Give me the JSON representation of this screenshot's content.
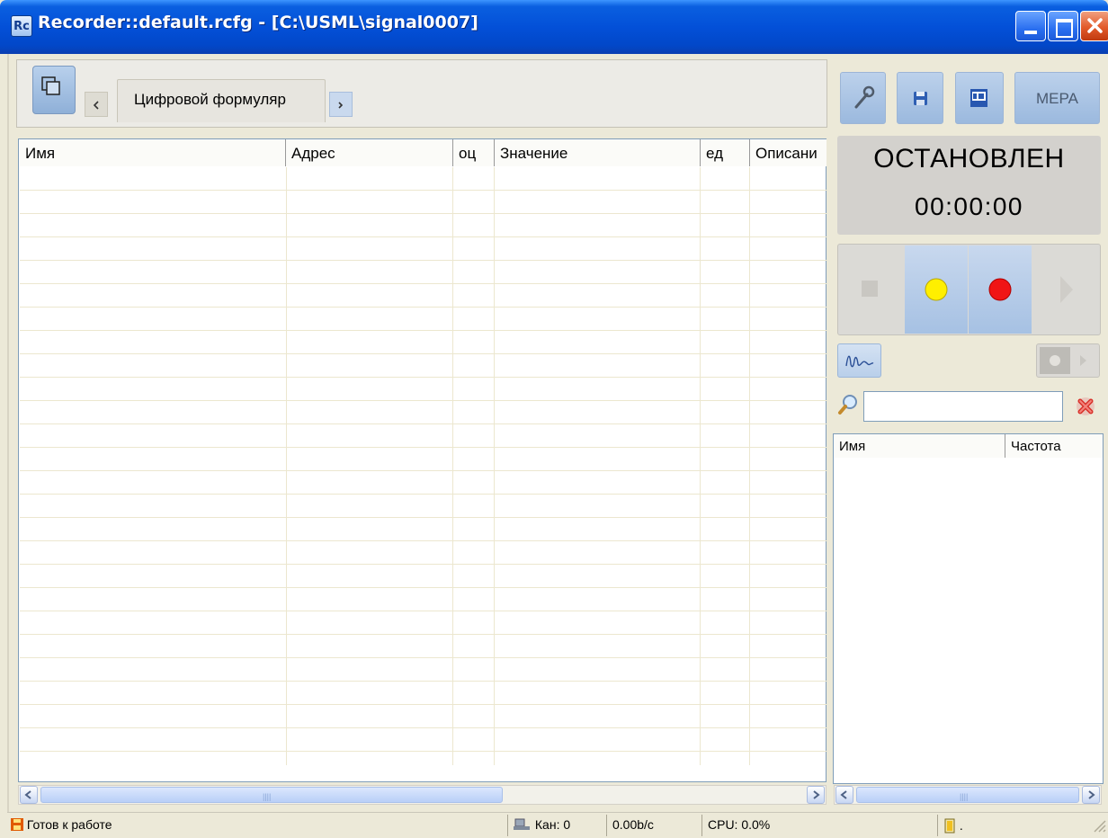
{
  "window": {
    "title": "Recorder::default.rcfg - [C:\\USML\\signal0007]",
    "icon": "Rc"
  },
  "tabs": {
    "active_label": "Цифровой формуляр"
  },
  "grid": {
    "columns": [
      "Имя",
      "Адрес",
      "оц",
      "Значение",
      "ед",
      "Описани"
    ],
    "rows": []
  },
  "toolbar": {
    "mera_label": "МЕРА",
    "icons": [
      "settings-wrench-icon",
      "save-icon",
      "doc-icon"
    ]
  },
  "recorder": {
    "status": "ОСТАНОВЛЕН",
    "timer": "00:00:00",
    "colors": {
      "pause": "#ffef00",
      "record": "#f01515"
    }
  },
  "search": {
    "value": "",
    "placeholder": ""
  },
  "channels": {
    "columns": [
      "Имя",
      "Частота"
    ],
    "rows": []
  },
  "statusbar": {
    "ready": "Готов к работе",
    "channels": "Кан: 0",
    "rate": "0.00b/c",
    "cpu": "CPU: 0.0%",
    "extra": "."
  }
}
